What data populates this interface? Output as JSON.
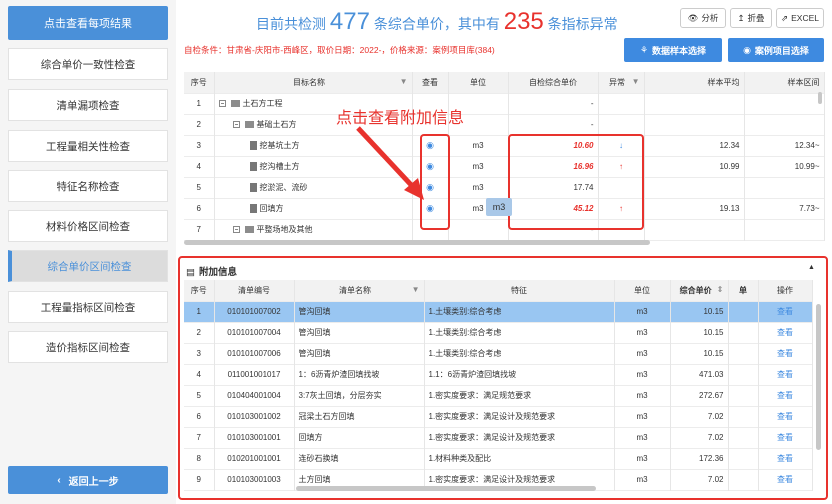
{
  "sidebar": {
    "header": "点击查看每项结果",
    "items": [
      "综合单价一致性检查",
      "清单漏项检查",
      "工程量相关性检查",
      "特征名称检查",
      "材料价格区间检查",
      "综合单价区间检查",
      "工程量指标区间检查",
      "造价指标区间检查"
    ],
    "active_index": 5,
    "back": "返回上一步"
  },
  "summary": {
    "prefix": "目前共检测",
    "total": "477",
    "mid": "条综合单价，其中有",
    "abnormal": "235",
    "suffix": "条指标异常"
  },
  "toolbar": {
    "analyze": "分析",
    "fold": "折叠",
    "excel": "EXCEL"
  },
  "condition": "自检条件：甘肃省-庆阳市-西峰区，取价日期：2022-，价格来源：案例项目库(384)",
  "buttons": {
    "sample": "数据样本选择",
    "case": "案例项目选择"
  },
  "main_table": {
    "headers": [
      "序号",
      "目标名称",
      "查看",
      "单位",
      "自检综合单价",
      "异常",
      "样本平均",
      "样本区间"
    ],
    "rows": [
      {
        "no": "1",
        "name": "土石方工程",
        "level": 0,
        "view": "",
        "unit": "",
        "price": "-",
        "anomaly": "",
        "avg": "",
        "range": ""
      },
      {
        "no": "2",
        "name": "基础土石方",
        "level": 1,
        "view": "",
        "unit": "",
        "price": "-",
        "anomaly": "",
        "avg": "",
        "range": ""
      },
      {
        "no": "3",
        "name": "挖基坑土方",
        "level": 2,
        "view": "eye",
        "unit": "m3",
        "price": "10.60",
        "anomaly": "↓",
        "avg": "12.34",
        "range": "12.34~"
      },
      {
        "no": "4",
        "name": "挖沟槽土方",
        "level": 2,
        "view": "eye",
        "unit": "m3",
        "price": "16.96",
        "anomaly": "↑",
        "avg": "10.99",
        "range": "10.99~"
      },
      {
        "no": "5",
        "name": "挖淤泥、流砂",
        "level": 2,
        "view": "eye",
        "unit": "m3",
        "price": "17.74",
        "anomaly": "",
        "avg": "",
        "range": ""
      },
      {
        "no": "6",
        "name": "回填方",
        "level": 2,
        "view": "eye",
        "unit": "m3",
        "price": "45.12",
        "anomaly": "↑",
        "avg": "19.13",
        "range": "7.73~"
      },
      {
        "no": "7",
        "name": "平整场地及其他",
        "level": 1,
        "view": "",
        "unit": "",
        "price": "-",
        "anomaly": "",
        "avg": "",
        "range": ""
      }
    ]
  },
  "annotation": "点击查看附加信息",
  "tooltip": "m3",
  "detail": {
    "title": "附加信息",
    "headers": [
      "序号",
      "清单编号",
      "清单名称",
      "特征",
      "单位",
      "综合单价",
      "单",
      "操作"
    ],
    "rows": [
      {
        "no": "1",
        "code": "010101007002",
        "name": "管沟回填",
        "feature": "1.土壤类别:综合考虑",
        "unit": "m3",
        "price": "10.15",
        "op": "查看"
      },
      {
        "no": "2",
        "code": "010101007004",
        "name": "管沟回填",
        "feature": "1.土壤类别:综合考虑",
        "unit": "m3",
        "price": "10.15",
        "op": "查看"
      },
      {
        "no": "3",
        "code": "010101007006",
        "name": "管沟回填",
        "feature": "1.土壤类别:综合考虑",
        "unit": "m3",
        "price": "10.15",
        "op": "查看"
      },
      {
        "no": "4",
        "code": "011001001017",
        "name": "1：6沥青炉渣回填找坡",
        "feature": "1.1：6沥青炉渣回填找坡",
        "unit": "m3",
        "price": "471.03",
        "op": "查看"
      },
      {
        "no": "5",
        "code": "010404001004",
        "name": "3:7灰土回填，分层夯实",
        "feature": "1.密实度要求：满足规范要求",
        "unit": "m3",
        "price": "272.67",
        "op": "查看"
      },
      {
        "no": "6",
        "code": "010103001002",
        "name": "冠梁土石方回填",
        "feature": "1.密实度要求：满足设计及规范要求",
        "unit": "m3",
        "price": "7.02",
        "op": "查看"
      },
      {
        "no": "7",
        "code": "010103001001",
        "name": "回填方",
        "feature": "1.密实度要求：满足设计及规范要求",
        "unit": "m3",
        "price": "7.02",
        "op": "查看"
      },
      {
        "no": "8",
        "code": "010201001001",
        "name": "连砂石换填",
        "feature": "1.材料种类及配比",
        "unit": "m3",
        "price": "172.36",
        "op": "查看"
      },
      {
        "no": "9",
        "code": "010103001003",
        "name": "土方回填",
        "feature": "1.密实度要求：满足设计及规范要求",
        "unit": "m3",
        "price": "7.02",
        "op": "查看"
      }
    ]
  },
  "colors": {
    "accent": "#4a90d9",
    "red": "#e8322d",
    "selected": "#99c6f2"
  }
}
